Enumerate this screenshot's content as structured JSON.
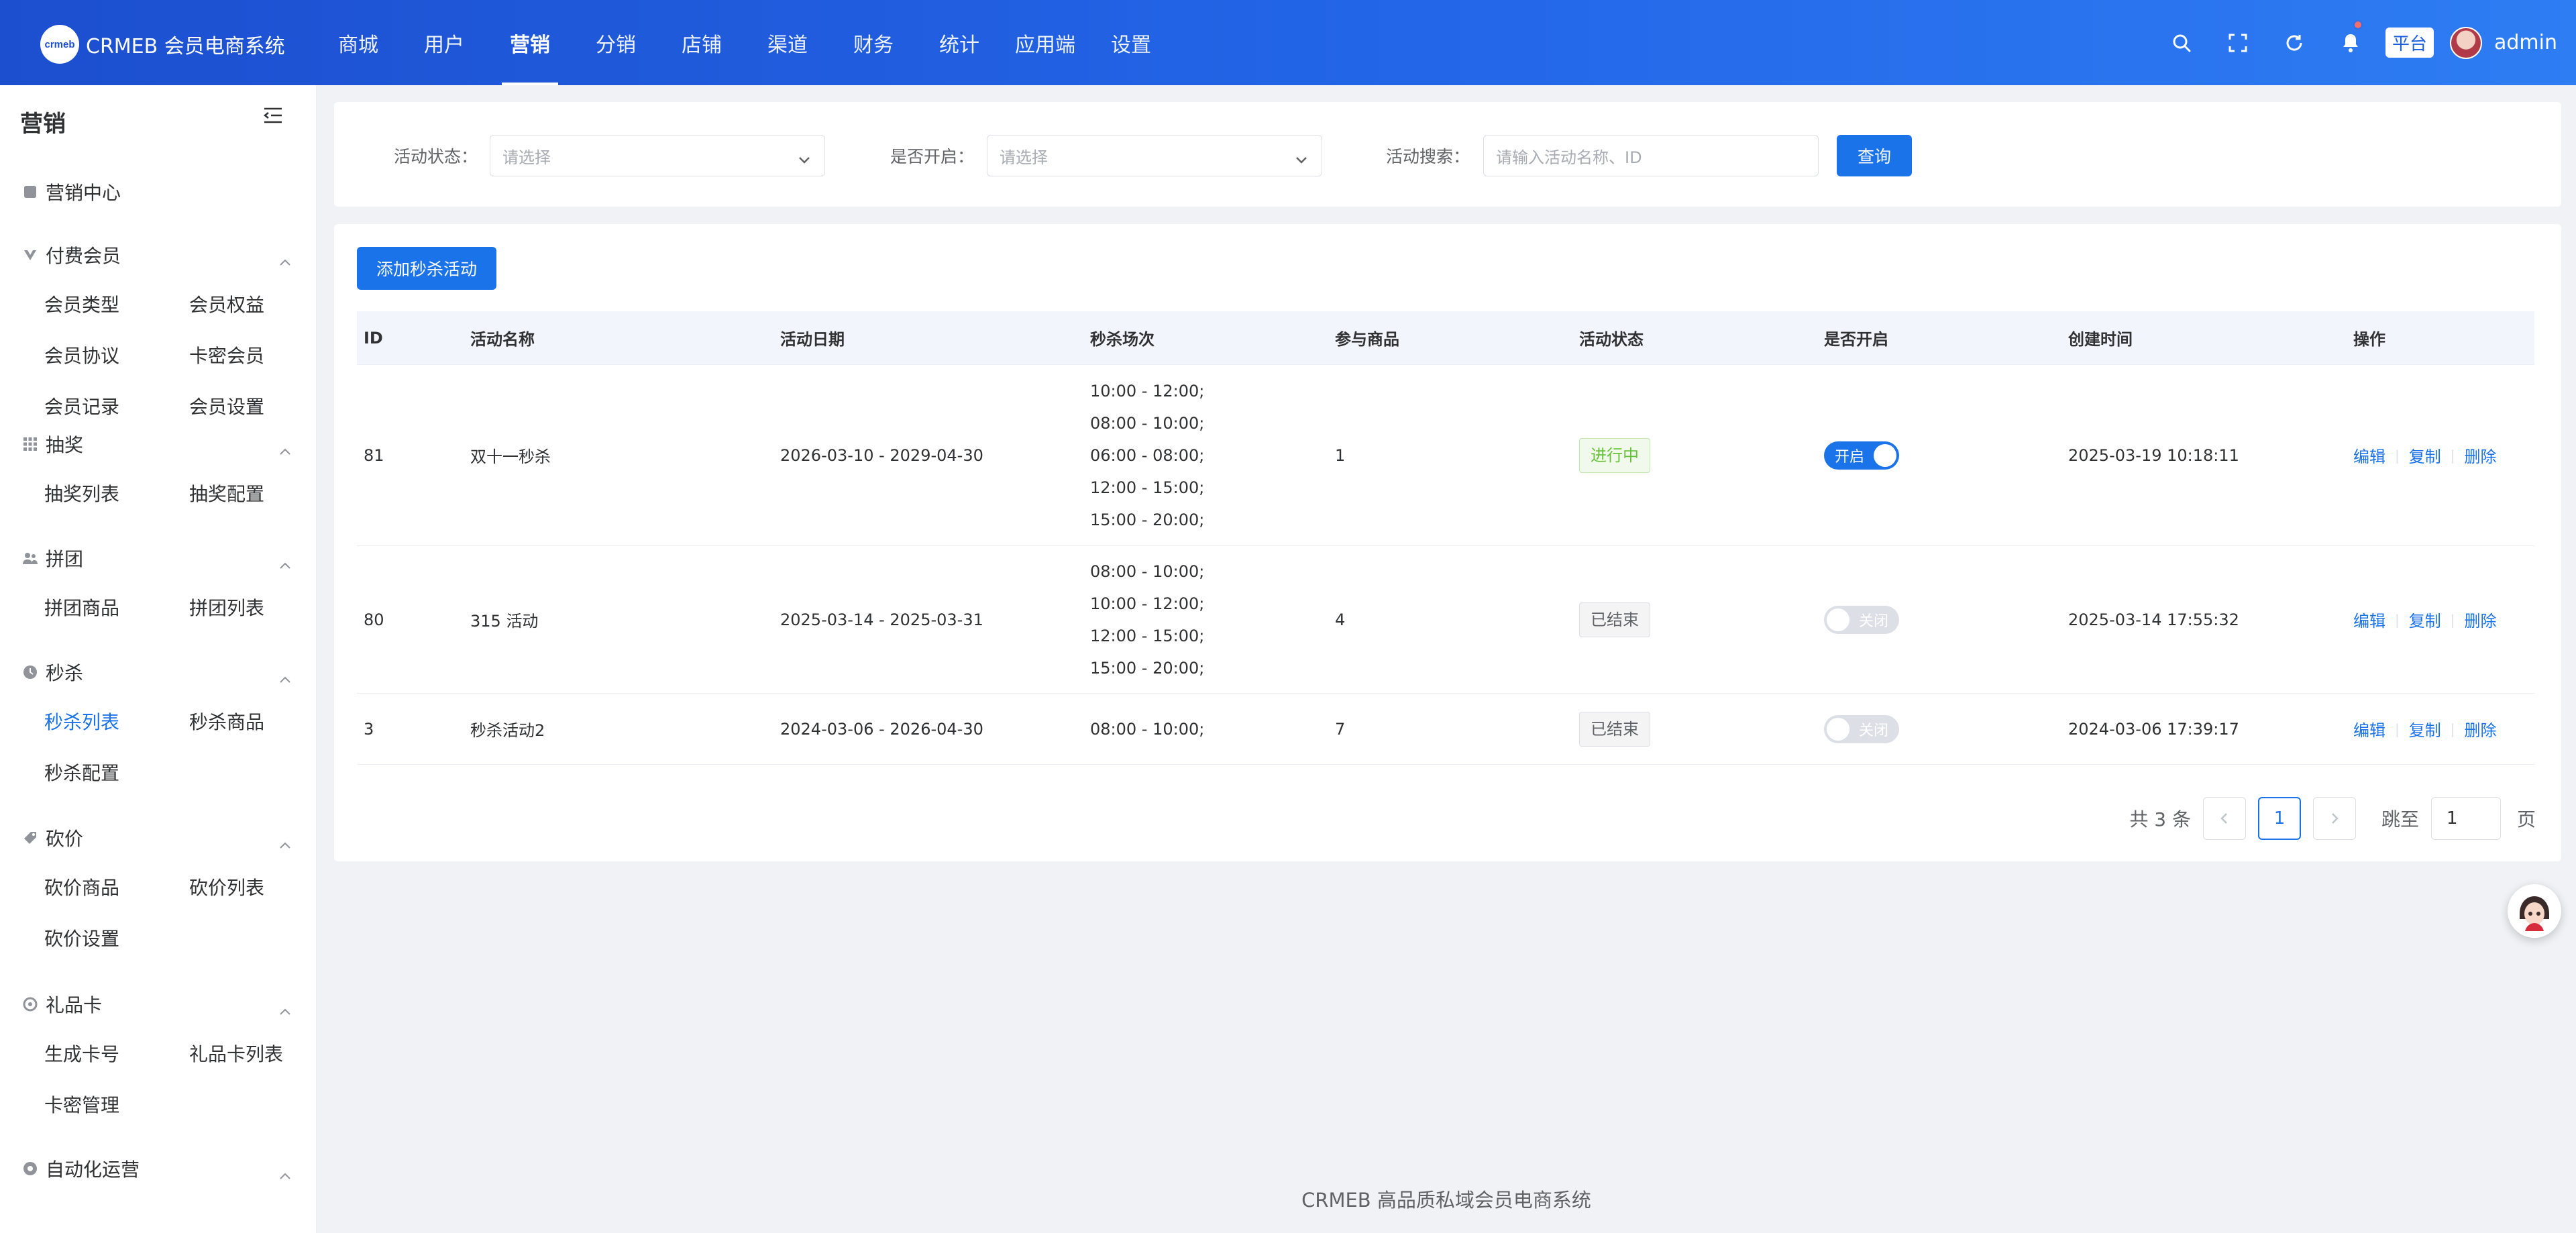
{
  "app": {
    "logo_badge": "crmeb",
    "title": "CRMEB 会员电商系统"
  },
  "nav": [
    "商城",
    "用户",
    "营销",
    "分销",
    "店铺",
    "渠道",
    "财务",
    "统计",
    "应用端",
    "设置"
  ],
  "nav_active": "营销",
  "header": {
    "platform": "平台",
    "user": "admin"
  },
  "sidebar": {
    "title": "营销",
    "center": "营销中心",
    "groups": [
      {
        "name": "付费会员",
        "icon": "vip-icon",
        "items": [
          "会员类型",
          "会员权益",
          "会员协议",
          "卡密会员",
          "会员记录",
          "会员设置"
        ]
      },
      {
        "name": "抽奖",
        "icon": "grid-icon",
        "items": [
          "抽奖列表",
          "抽奖配置"
        ]
      },
      {
        "name": "拼团",
        "icon": "group-icon",
        "items": [
          "拼团商品",
          "拼团列表"
        ]
      },
      {
        "name": "秒杀",
        "icon": "clock-icon",
        "items": [
          "秒杀列表",
          "秒杀商品",
          "秒杀配置"
        ]
      },
      {
        "name": "砍价",
        "icon": "tag-icon",
        "items": [
          "砍价商品",
          "砍价列表",
          "砍价设置"
        ]
      },
      {
        "name": "礼品卡",
        "icon": "gift-icon",
        "items": [
          "生成卡号",
          "礼品卡列表",
          "卡密管理"
        ]
      },
      {
        "name": "自动化运营",
        "icon": "auto-icon",
        "items": []
      }
    ],
    "active_item": "秒杀列表"
  },
  "filters": {
    "status_label": "活动状态：",
    "status_placeholder": "请选择",
    "open_label": "是否开启：",
    "open_placeholder": "请选择",
    "search_label": "活动搜索：",
    "search_placeholder": "请输入活动名称、ID",
    "query_button": "查询"
  },
  "table": {
    "add_button": "添加秒杀活动",
    "columns": [
      "ID",
      "活动名称",
      "活动日期",
      "秒杀场次",
      "参与商品",
      "活动状态",
      "是否开启",
      "创建时间",
      "操作"
    ],
    "rows": [
      {
        "id": "81",
        "name": "双十一秒杀",
        "date": "2026-03-10 - 2029-04-30",
        "times": [
          "10:00 - 12:00;",
          "08:00 - 10:00;",
          "06:00 - 08:00;",
          "12:00 - 15:00;",
          "15:00 - 20:00;"
        ],
        "goods": "1",
        "status": "进行中",
        "status_type": "on",
        "enabled": true,
        "switch_text": "开启",
        "created": "2025-03-19 10:18:11"
      },
      {
        "id": "80",
        "name": "315 活动",
        "date": "2025-03-14 - 2025-03-31",
        "times": [
          "08:00 - 10:00;",
          "10:00 - 12:00;",
          "12:00 - 15:00;",
          "15:00 - 20:00;"
        ],
        "goods": "4",
        "status": "已结束",
        "status_type": "off",
        "enabled": false,
        "switch_text": "关闭",
        "created": "2025-03-14 17:55:32"
      },
      {
        "id": "3",
        "name": "秒杀活动2",
        "date": "2024-03-06 - 2026-04-30",
        "times": [
          "08:00 - 10:00;"
        ],
        "goods": "7",
        "status": "已结束",
        "status_type": "off",
        "enabled": false,
        "switch_text": "关闭",
        "created": "2024-03-06 17:39:17"
      }
    ],
    "ops": [
      "编辑",
      "复制",
      "删除"
    ]
  },
  "pagination": {
    "total": "共 3 条",
    "current": "1",
    "jump_label": "跳至",
    "jump_value": "1",
    "page_suffix": "页"
  },
  "footer": "CRMEB 高品质私域会员电商系统",
  "colors": {
    "accent": "#1a73e8",
    "header_start": "#1c4fcf",
    "header_end": "#2e7df3",
    "success": "#67c23a"
  }
}
